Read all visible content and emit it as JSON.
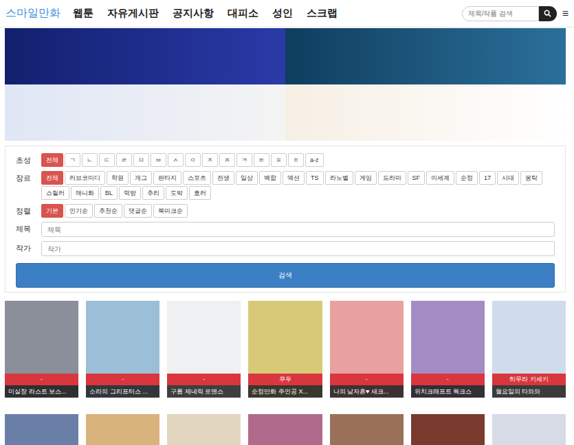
{
  "header": {
    "logo": "스마일만화",
    "nav": [
      {
        "label": "웹툰"
      },
      {
        "label": "자유게시판"
      },
      {
        "label": "공지사항"
      },
      {
        "label": "대피소"
      },
      {
        "label": "성인"
      },
      {
        "label": "스크랩"
      }
    ],
    "search": {
      "placeholder": "제목/작품 검색"
    },
    "menu_icon": "≡"
  },
  "filters": {
    "rows": [
      {
        "label": "초성",
        "options": [
          {
            "label": "전체",
            "selected": true
          },
          {
            "label": "ㄱ",
            "selected": false
          },
          {
            "label": "ㄴ",
            "selected": false
          },
          {
            "label": "ㄷ",
            "selected": false
          },
          {
            "label": "ㄹ",
            "selected": false
          },
          {
            "label": "ㅁ",
            "selected": false
          },
          {
            "label": "ㅂ",
            "selected": false
          },
          {
            "label": "ㅅ",
            "selected": false
          },
          {
            "label": "ㅇ",
            "selected": false
          },
          {
            "label": "ㅈ",
            "selected": false
          },
          {
            "label": "ㅊ",
            "selected": false
          },
          {
            "label": "ㅋ",
            "selected": false
          },
          {
            "label": "ㅌ",
            "selected": false
          },
          {
            "label": "ㅍ",
            "selected": false
          },
          {
            "label": "ㅎ",
            "selected": false
          },
          {
            "label": "a-z",
            "selected": false
          }
        ]
      },
      {
        "label": "장르",
        "options": [
          {
            "label": "전체",
            "selected": true
          },
          {
            "label": "러브코미디",
            "selected": false
          },
          {
            "label": "학원",
            "selected": false
          },
          {
            "label": "개그",
            "selected": false
          },
          {
            "label": "판타지",
            "selected": false
          },
          {
            "label": "스포츠",
            "selected": false
          },
          {
            "label": "전생",
            "selected": false
          },
          {
            "label": "일상",
            "selected": false
          },
          {
            "label": "백합",
            "selected": false
          },
          {
            "label": "액션",
            "selected": false
          },
          {
            "label": "TS",
            "selected": false
          },
          {
            "label": "라노벨",
            "selected": false
          },
          {
            "label": "게임",
            "selected": false
          },
          {
            "label": "드라마",
            "selected": false
          },
          {
            "label": "SF",
            "selected": false
          },
          {
            "label": "이세계",
            "selected": false
          },
          {
            "label": "순정",
            "selected": false
          },
          {
            "label": "17",
            "selected": false
          },
          {
            "label": "시대",
            "selected": false
          },
          {
            "label": "봉탁",
            "selected": false
          },
          {
            "label": "스릴러",
            "selected": false
          },
          {
            "label": "애니화",
            "selected": false
          },
          {
            "label": "BL",
            "selected": false
          },
          {
            "label": "먹방",
            "selected": false
          },
          {
            "label": "추리",
            "selected": false
          },
          {
            "label": "도박",
            "selected": false
          },
          {
            "label": "호러",
            "selected": false
          }
        ]
      },
      {
        "label": "정렬",
        "options": [
          {
            "label": "기본",
            "selected": true
          },
          {
            "label": "인기순",
            "selected": false
          },
          {
            "label": "추천순",
            "selected": false
          },
          {
            "label": "댓글순",
            "selected": false
          },
          {
            "label": "북마크순",
            "selected": false
          }
        ]
      }
    ],
    "fields": [
      {
        "label": "제목",
        "placeholder": "제목"
      },
      {
        "label": "작가",
        "placeholder": "작가"
      }
    ],
    "search_button": "검색"
  },
  "cards": [
    {
      "author": "-",
      "title": "미실장 라스트 보스..."
    },
    {
      "author": "-",
      "title": "소라의 그리프터스 ..."
    },
    {
      "author": "-",
      "title": "구름 제네릭 로맨스"
    },
    {
      "author": "쿠우",
      "title": "순정만화 주인공 X..."
    },
    {
      "author": "-",
      "title": "나의 남자혼♥ 새크..."
    },
    {
      "author": "-",
      "title": "위치크래프트 웍크스"
    },
    {
      "author": "히무라 키세키",
      "title": "월요일의 타와와"
    }
  ],
  "partial_covers": 7
}
